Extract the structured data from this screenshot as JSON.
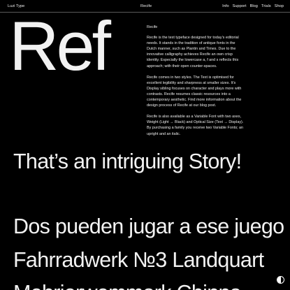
{
  "header": {
    "brand": "Luzi Type",
    "product": "Recife",
    "nav": [
      "Info",
      "Support",
      "Blog",
      "Trials",
      "Shop"
    ]
  },
  "hero": {
    "big_sample": "Ref"
  },
  "description": {
    "title": "Recife",
    "paragraphs": [
      "Recife is the text typeface designed for today’s editorial needs. It stands in the tradition of antique fonts in the Dutch manner, such as Plantin and Times. Due to the innovative calligraphy achieves Recife an own crisp identity. Especially the lowercase a, f and s reflects this approach; with their open counter-spaces.",
      "Recife comes in two styles. The Text is optimised for excellent legibility and sharpness at smaller sizes. It’s Display sibling focuses on character and plays more with contrasts. Recife resumes classic resources into a contemporary aesthetic. Find more information about the design process of Recife at our blog post.",
      "Recife is also available as a Variable Font with two axes, Weight (Light → Black) and Optical Size (Text → Display). By purchasing a family you receive two Variable Fonts; an upright and an italic."
    ]
  },
  "samples": [
    "That’s an intriguing Story!",
    "Dos pueden jugar a ese juego",
    "Fahrradwerk №3 Landquart",
    "Mehrjerwemmark Chinna"
  ],
  "colors": {
    "background": "#000000",
    "text": "#f2f2f2",
    "rule": "#5a5a5a"
  },
  "icons": {
    "theme_toggle": "contrast-toggle-icon"
  }
}
